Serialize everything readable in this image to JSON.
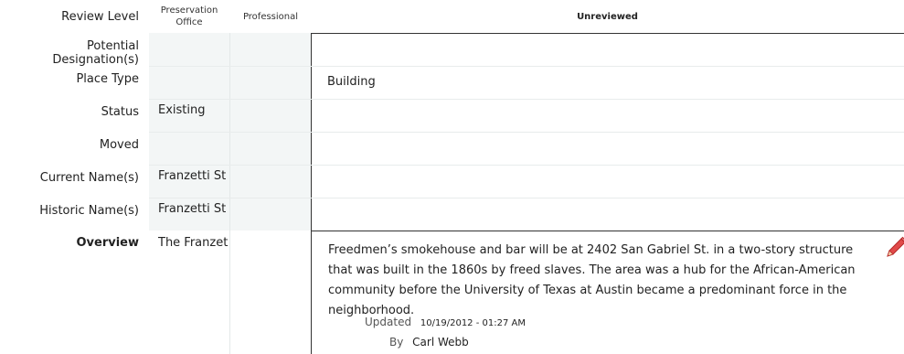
{
  "header": {
    "review_level": "Review Level",
    "preservation_office": "Preservation Office",
    "professional": "Professional",
    "unreviewed": "Unreviewed"
  },
  "rows": [
    {
      "label": "Potential Designation(s)",
      "pres": "",
      "prof": "",
      "unrev": ""
    },
    {
      "label": "Place Type",
      "pres": "",
      "prof": "",
      "unrev": "Building"
    },
    {
      "label": "Status",
      "pres": "Existing",
      "prof": "",
      "unrev": ""
    },
    {
      "label": "Moved",
      "pres": "",
      "prof": "",
      "unrev": ""
    },
    {
      "label": "Current Name(s)",
      "pres": "Franzetti St",
      "prof": "",
      "unrev": ""
    },
    {
      "label": "Historic Name(s)",
      "pres": "Franzetti St",
      "prof": "",
      "unrev": ""
    }
  ],
  "overview": {
    "label": "Overview",
    "pres": "The Franzet",
    "text": "Freedmen’s smokehouse and bar will be at 2402 San Gabriel St. in a two-story structure that was built in the 1860s by freed slaves. The area was a hub for the African-American community before the University of Texas at Austin became a predominant force in the neighborhood.",
    "updated_label": "Updated",
    "updated_value": "10/19/2012 - 01:27 AM",
    "by_label": "By",
    "by_value": "Carl Webb",
    "edit_icon": "pencil-icon"
  }
}
